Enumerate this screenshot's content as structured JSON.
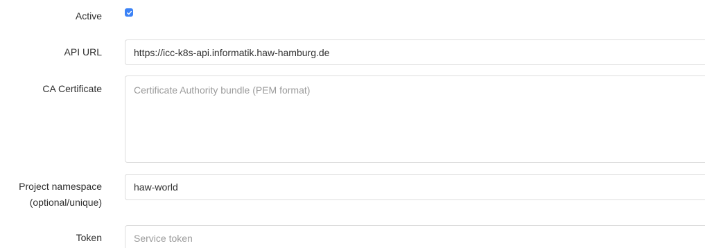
{
  "active": {
    "label": "Active",
    "checked": true,
    "accent_color": "#3b82f6",
    "icon": "check-icon"
  },
  "api_url": {
    "label": "API URL",
    "value": "https://icc-k8s-api.informatik.haw-hamburg.de"
  },
  "ca_certificate": {
    "label": "CA Certificate",
    "placeholder": "Certificate Authority bundle (PEM format)"
  },
  "project_namespace": {
    "label_line1": "Project namespace",
    "label_line2": "(optional/unique)",
    "value": "haw-world"
  },
  "token": {
    "label": "Token",
    "placeholder": "Service token"
  }
}
